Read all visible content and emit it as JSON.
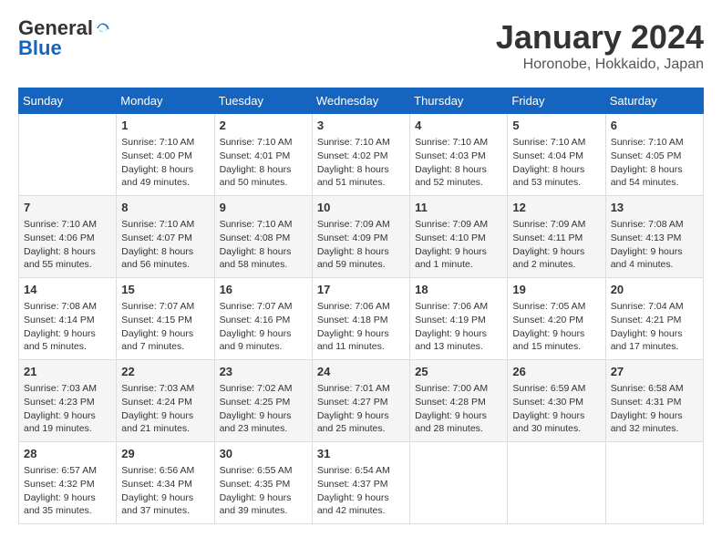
{
  "header": {
    "logo_general": "General",
    "logo_blue": "Blue",
    "title": "January 2024",
    "subtitle": "Horonobe, Hokkaido, Japan"
  },
  "weekdays": [
    "Sunday",
    "Monday",
    "Tuesday",
    "Wednesday",
    "Thursday",
    "Friday",
    "Saturday"
  ],
  "weeks": [
    [
      {
        "day": "",
        "info": ""
      },
      {
        "day": "1",
        "info": "Sunrise: 7:10 AM\nSunset: 4:00 PM\nDaylight: 8 hours\nand 49 minutes."
      },
      {
        "day": "2",
        "info": "Sunrise: 7:10 AM\nSunset: 4:01 PM\nDaylight: 8 hours\nand 50 minutes."
      },
      {
        "day": "3",
        "info": "Sunrise: 7:10 AM\nSunset: 4:02 PM\nDaylight: 8 hours\nand 51 minutes."
      },
      {
        "day": "4",
        "info": "Sunrise: 7:10 AM\nSunset: 4:03 PM\nDaylight: 8 hours\nand 52 minutes."
      },
      {
        "day": "5",
        "info": "Sunrise: 7:10 AM\nSunset: 4:04 PM\nDaylight: 8 hours\nand 53 minutes."
      },
      {
        "day": "6",
        "info": "Sunrise: 7:10 AM\nSunset: 4:05 PM\nDaylight: 8 hours\nand 54 minutes."
      }
    ],
    [
      {
        "day": "7",
        "info": "Sunrise: 7:10 AM\nSunset: 4:06 PM\nDaylight: 8 hours\nand 55 minutes."
      },
      {
        "day": "8",
        "info": "Sunrise: 7:10 AM\nSunset: 4:07 PM\nDaylight: 8 hours\nand 56 minutes."
      },
      {
        "day": "9",
        "info": "Sunrise: 7:10 AM\nSunset: 4:08 PM\nDaylight: 8 hours\nand 58 minutes."
      },
      {
        "day": "10",
        "info": "Sunrise: 7:09 AM\nSunset: 4:09 PM\nDaylight: 8 hours\nand 59 minutes."
      },
      {
        "day": "11",
        "info": "Sunrise: 7:09 AM\nSunset: 4:10 PM\nDaylight: 9 hours\nand 1 minute."
      },
      {
        "day": "12",
        "info": "Sunrise: 7:09 AM\nSunset: 4:11 PM\nDaylight: 9 hours\nand 2 minutes."
      },
      {
        "day": "13",
        "info": "Sunrise: 7:08 AM\nSunset: 4:13 PM\nDaylight: 9 hours\nand 4 minutes."
      }
    ],
    [
      {
        "day": "14",
        "info": "Sunrise: 7:08 AM\nSunset: 4:14 PM\nDaylight: 9 hours\nand 5 minutes."
      },
      {
        "day": "15",
        "info": "Sunrise: 7:07 AM\nSunset: 4:15 PM\nDaylight: 9 hours\nand 7 minutes."
      },
      {
        "day": "16",
        "info": "Sunrise: 7:07 AM\nSunset: 4:16 PM\nDaylight: 9 hours\nand 9 minutes."
      },
      {
        "day": "17",
        "info": "Sunrise: 7:06 AM\nSunset: 4:18 PM\nDaylight: 9 hours\nand 11 minutes."
      },
      {
        "day": "18",
        "info": "Sunrise: 7:06 AM\nSunset: 4:19 PM\nDaylight: 9 hours\nand 13 minutes."
      },
      {
        "day": "19",
        "info": "Sunrise: 7:05 AM\nSunset: 4:20 PM\nDaylight: 9 hours\nand 15 minutes."
      },
      {
        "day": "20",
        "info": "Sunrise: 7:04 AM\nSunset: 4:21 PM\nDaylight: 9 hours\nand 17 minutes."
      }
    ],
    [
      {
        "day": "21",
        "info": "Sunrise: 7:03 AM\nSunset: 4:23 PM\nDaylight: 9 hours\nand 19 minutes."
      },
      {
        "day": "22",
        "info": "Sunrise: 7:03 AM\nSunset: 4:24 PM\nDaylight: 9 hours\nand 21 minutes."
      },
      {
        "day": "23",
        "info": "Sunrise: 7:02 AM\nSunset: 4:25 PM\nDaylight: 9 hours\nand 23 minutes."
      },
      {
        "day": "24",
        "info": "Sunrise: 7:01 AM\nSunset: 4:27 PM\nDaylight: 9 hours\nand 25 minutes."
      },
      {
        "day": "25",
        "info": "Sunrise: 7:00 AM\nSunset: 4:28 PM\nDaylight: 9 hours\nand 28 minutes."
      },
      {
        "day": "26",
        "info": "Sunrise: 6:59 AM\nSunset: 4:30 PM\nDaylight: 9 hours\nand 30 minutes."
      },
      {
        "day": "27",
        "info": "Sunrise: 6:58 AM\nSunset: 4:31 PM\nDaylight: 9 hours\nand 32 minutes."
      }
    ],
    [
      {
        "day": "28",
        "info": "Sunrise: 6:57 AM\nSunset: 4:32 PM\nDaylight: 9 hours\nand 35 minutes."
      },
      {
        "day": "29",
        "info": "Sunrise: 6:56 AM\nSunset: 4:34 PM\nDaylight: 9 hours\nand 37 minutes."
      },
      {
        "day": "30",
        "info": "Sunrise: 6:55 AM\nSunset: 4:35 PM\nDaylight: 9 hours\nand 39 minutes."
      },
      {
        "day": "31",
        "info": "Sunrise: 6:54 AM\nSunset: 4:37 PM\nDaylight: 9 hours\nand 42 minutes."
      },
      {
        "day": "",
        "info": ""
      },
      {
        "day": "",
        "info": ""
      },
      {
        "day": "",
        "info": ""
      }
    ]
  ]
}
